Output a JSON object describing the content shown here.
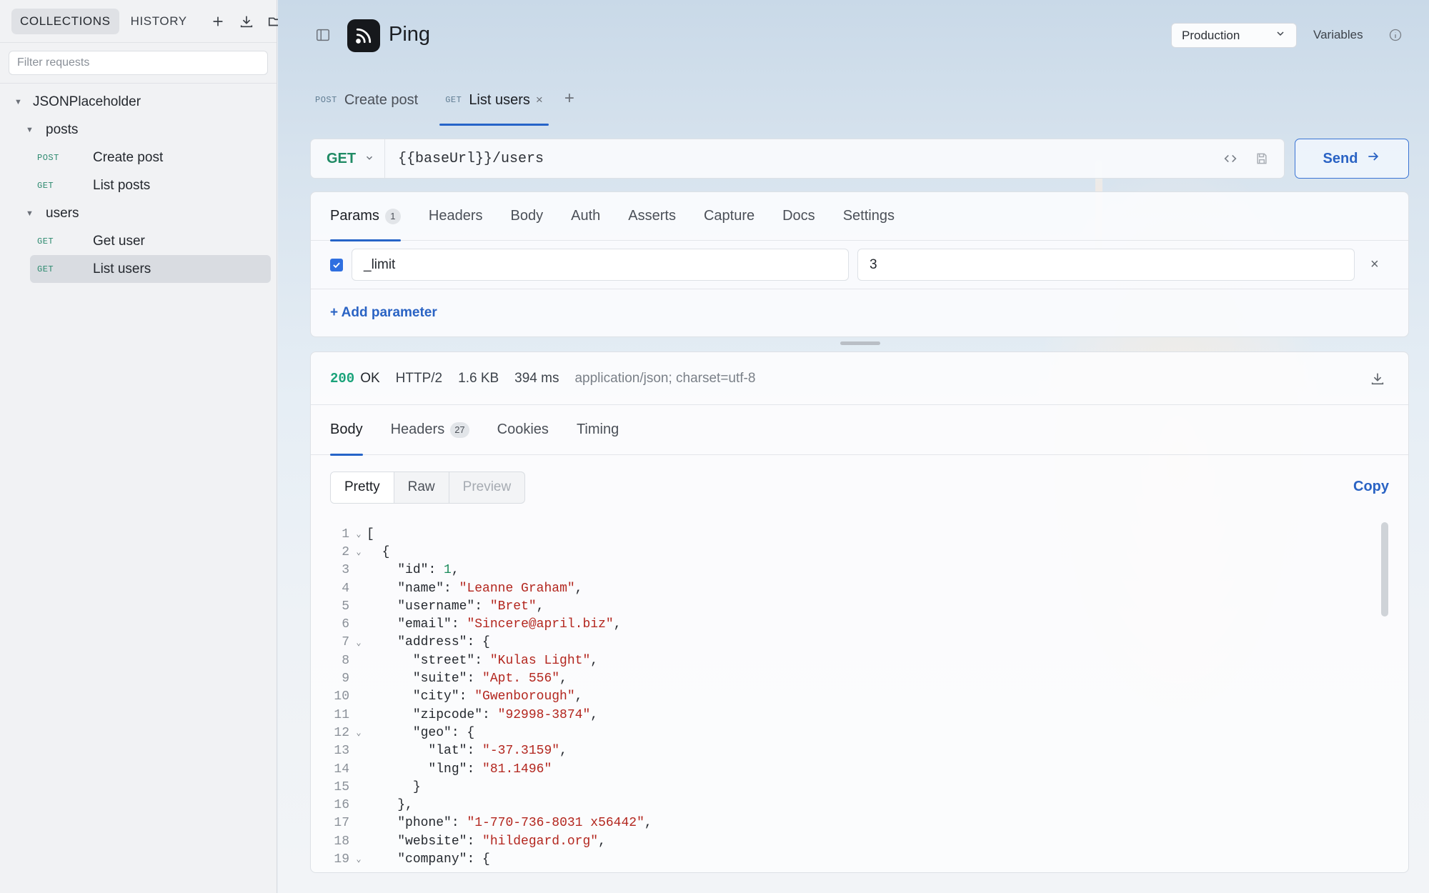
{
  "sidebar": {
    "tabs": [
      {
        "label": "COLLECTIONS",
        "active": true
      },
      {
        "label": "HISTORY",
        "active": false
      }
    ],
    "icons": [
      "plus-icon",
      "download-icon",
      "folder-icon"
    ],
    "filter_placeholder": "Filter requests",
    "tree": {
      "collection": "JSONPlaceholder",
      "folders": [
        {
          "name": "posts",
          "requests": [
            {
              "method": "POST",
              "name": "Create post"
            },
            {
              "method": "GET",
              "name": "List posts"
            }
          ]
        },
        {
          "name": "users",
          "requests": [
            {
              "method": "GET",
              "name": "Get user"
            },
            {
              "method": "GET",
              "name": "List users",
              "selected": true
            }
          ]
        }
      ]
    }
  },
  "header": {
    "app_title": "Ping",
    "environment": "Production",
    "variables_label": "Variables"
  },
  "request_tabs": [
    {
      "method": "POST",
      "label": "Create post",
      "active": false
    },
    {
      "method": "GET",
      "label": "List users",
      "active": true,
      "close": "×"
    }
  ],
  "add_tab": "+",
  "url_bar": {
    "method": "GET",
    "url": "{{baseUrl}}/users",
    "send_label": "Send"
  },
  "params_panel": {
    "tabs": [
      {
        "label": "Params",
        "badge": "1",
        "active": true
      },
      {
        "label": "Headers"
      },
      {
        "label": "Body"
      },
      {
        "label": "Auth"
      },
      {
        "label": "Asserts"
      },
      {
        "label": "Capture"
      },
      {
        "label": "Docs"
      },
      {
        "label": "Settings"
      }
    ],
    "params": [
      {
        "enabled": true,
        "key": "_limit",
        "value": "3"
      }
    ],
    "remove": "×",
    "add_param_label": "+ Add parameter"
  },
  "response": {
    "status_code": "200",
    "status_text": "OK",
    "protocol": "HTTP/2",
    "size": "1.6 KB",
    "time": "394 ms",
    "content_type": "application/json; charset=utf-8",
    "tabs": [
      {
        "label": "Body",
        "active": true
      },
      {
        "label": "Headers",
        "badge": "27"
      },
      {
        "label": "Cookies"
      },
      {
        "label": "Timing"
      }
    ],
    "view_modes": [
      {
        "label": "Pretty",
        "active": true
      },
      {
        "label": "Raw"
      },
      {
        "label": "Preview",
        "disabled": true
      }
    ],
    "copy_label": "Copy",
    "body_lines": [
      {
        "n": "1",
        "fold": true,
        "indent": 0,
        "parts": [
          [
            "p",
            "["
          ]
        ]
      },
      {
        "n": "2",
        "fold": true,
        "indent": 1,
        "parts": [
          [
            "p",
            "{"
          ]
        ]
      },
      {
        "n": "3",
        "fold": false,
        "indent": 2,
        "parts": [
          [
            "k",
            "\"id\""
          ],
          [
            "p",
            ": "
          ],
          [
            "n",
            "1"
          ],
          [
            "p",
            ","
          ]
        ]
      },
      {
        "n": "4",
        "fold": false,
        "indent": 2,
        "parts": [
          [
            "k",
            "\"name\""
          ],
          [
            "p",
            ": "
          ],
          [
            "s",
            "\"Leanne Graham\""
          ],
          [
            "p",
            ","
          ]
        ]
      },
      {
        "n": "5",
        "fold": false,
        "indent": 2,
        "parts": [
          [
            "k",
            "\"username\""
          ],
          [
            "p",
            ": "
          ],
          [
            "s",
            "\"Bret\""
          ],
          [
            "p",
            ","
          ]
        ]
      },
      {
        "n": "6",
        "fold": false,
        "indent": 2,
        "parts": [
          [
            "k",
            "\"email\""
          ],
          [
            "p",
            ": "
          ],
          [
            "s",
            "\"Sincere@april.biz\""
          ],
          [
            "p",
            ","
          ]
        ]
      },
      {
        "n": "7",
        "fold": true,
        "indent": 2,
        "parts": [
          [
            "k",
            "\"address\""
          ],
          [
            "p",
            ": {"
          ]
        ]
      },
      {
        "n": "8",
        "fold": false,
        "indent": 3,
        "parts": [
          [
            "k",
            "\"street\""
          ],
          [
            "p",
            ": "
          ],
          [
            "s",
            "\"Kulas Light\""
          ],
          [
            "p",
            ","
          ]
        ]
      },
      {
        "n": "9",
        "fold": false,
        "indent": 3,
        "parts": [
          [
            "k",
            "\"suite\""
          ],
          [
            "p",
            ": "
          ],
          [
            "s",
            "\"Apt. 556\""
          ],
          [
            "p",
            ","
          ]
        ]
      },
      {
        "n": "10",
        "fold": false,
        "indent": 3,
        "parts": [
          [
            "k",
            "\"city\""
          ],
          [
            "p",
            ": "
          ],
          [
            "s",
            "\"Gwenborough\""
          ],
          [
            "p",
            ","
          ]
        ]
      },
      {
        "n": "11",
        "fold": false,
        "indent": 3,
        "parts": [
          [
            "k",
            "\"zipcode\""
          ],
          [
            "p",
            ": "
          ],
          [
            "s",
            "\"92998-3874\""
          ],
          [
            "p",
            ","
          ]
        ]
      },
      {
        "n": "12",
        "fold": true,
        "indent": 3,
        "parts": [
          [
            "k",
            "\"geo\""
          ],
          [
            "p",
            ": {"
          ]
        ]
      },
      {
        "n": "13",
        "fold": false,
        "indent": 4,
        "parts": [
          [
            "k",
            "\"lat\""
          ],
          [
            "p",
            ": "
          ],
          [
            "s",
            "\"-37.3159\""
          ],
          [
            "p",
            ","
          ]
        ]
      },
      {
        "n": "14",
        "fold": false,
        "indent": 4,
        "parts": [
          [
            "k",
            "\"lng\""
          ],
          [
            "p",
            ": "
          ],
          [
            "s",
            "\"81.1496\""
          ]
        ]
      },
      {
        "n": "15",
        "fold": false,
        "indent": 3,
        "parts": [
          [
            "p",
            "}"
          ]
        ]
      },
      {
        "n": "16",
        "fold": false,
        "indent": 2,
        "parts": [
          [
            "p",
            "},"
          ]
        ]
      },
      {
        "n": "17",
        "fold": false,
        "indent": 2,
        "parts": [
          [
            "k",
            "\"phone\""
          ],
          [
            "p",
            ": "
          ],
          [
            "s",
            "\"1-770-736-8031 x56442\""
          ],
          [
            "p",
            ","
          ]
        ]
      },
      {
        "n": "18",
        "fold": false,
        "indent": 2,
        "parts": [
          [
            "k",
            "\"website\""
          ],
          [
            "p",
            ": "
          ],
          [
            "s",
            "\"hildegard.org\""
          ],
          [
            "p",
            ","
          ]
        ]
      },
      {
        "n": "19",
        "fold": true,
        "indent": 2,
        "parts": [
          [
            "k",
            "\"company\""
          ],
          [
            "p",
            ": {"
          ]
        ]
      }
    ]
  },
  "colors": {
    "accent": "#2664c8",
    "get_method": "#2d8a6f",
    "status_ok": "#1aa37a",
    "json_string": "#b3261e"
  }
}
